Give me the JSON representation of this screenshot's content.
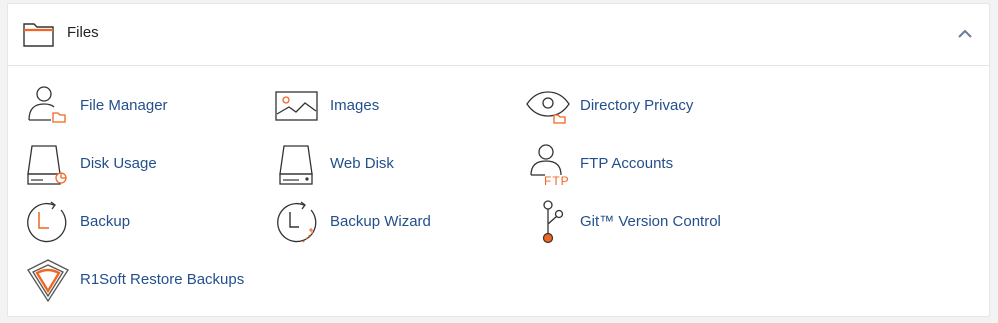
{
  "section": {
    "title": "Files",
    "icon": "folder-icon",
    "collapse_icon": "chevron-up-icon"
  },
  "colors": {
    "link": "#23508c",
    "accent": "#f26522",
    "icon_stroke": "#333333"
  },
  "items": [
    {
      "label": "File Manager",
      "icon": "user-folder-icon"
    },
    {
      "label": "Images",
      "icon": "image-icon"
    },
    {
      "label": "Directory Privacy",
      "icon": "eye-folder-icon"
    },
    {
      "label": "Disk Usage",
      "icon": "disk-usage-icon"
    },
    {
      "label": "Web Disk",
      "icon": "drive-icon"
    },
    {
      "label": "FTP Accounts",
      "icon": "user-ftp-icon",
      "icon_text": "FTP"
    },
    {
      "label": "Backup",
      "icon": "clock-rotate-icon"
    },
    {
      "label": "Backup Wizard",
      "icon": "clock-wand-icon"
    },
    {
      "label": "Git™ Version Control",
      "icon": "git-branch-icon"
    },
    {
      "label": "R1Soft Restore Backups",
      "icon": "r1soft-shield-icon"
    }
  ]
}
